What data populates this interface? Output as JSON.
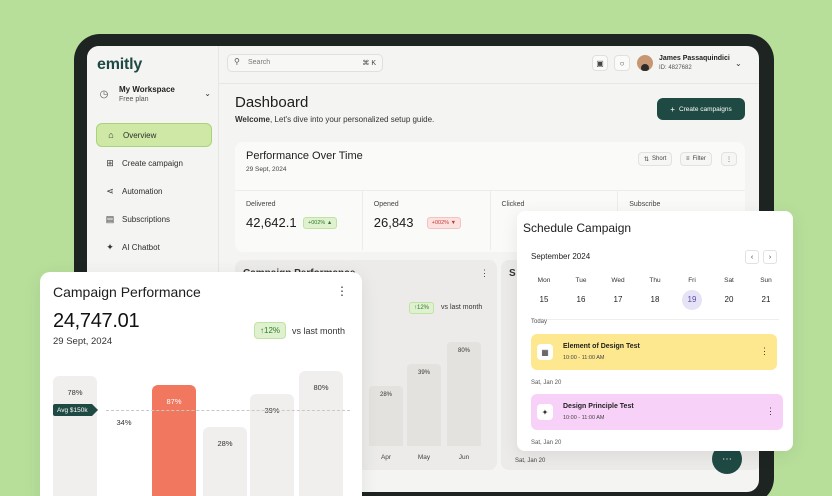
{
  "brand": {
    "logo": "emitly"
  },
  "workspace": {
    "name": "My Workspace",
    "plan": "Free plan"
  },
  "nav": [
    {
      "label": "Overview",
      "icon": "home-icon",
      "active": true
    },
    {
      "label": "Create campaign",
      "icon": "plus-square-icon"
    },
    {
      "label": "Automation",
      "icon": "share-nodes-icon"
    },
    {
      "label": "Subscriptions",
      "icon": "ticket-icon"
    },
    {
      "label": "AI Chatbot",
      "icon": "sparkle-icon"
    }
  ],
  "search": {
    "placeholder": "Search",
    "shortcut": "⌘  K"
  },
  "user": {
    "name": "James Passaquindici",
    "id": "ID: 4827682"
  },
  "dashboard": {
    "title": "Dashboard",
    "welcome_bold": "Welcome",
    "welcome_rest": ", Let's dive into your personalized setup guide.",
    "create_button": "Create campaigns"
  },
  "performance": {
    "title": "Performance Over Time",
    "date": "29 Sept, 2024",
    "short_label": "Short",
    "filter_label": "Filter",
    "metrics": [
      {
        "label": "Delivered",
        "value": "42,642.1",
        "change": "+002%",
        "trend": "up"
      },
      {
        "label": "Opened",
        "value": "26,843",
        "change": "+002%",
        "trend": "down"
      },
      {
        "label": "Clicked",
        "value": "",
        "change": "",
        "trend": ""
      },
      {
        "label": "Subscribe",
        "value": "",
        "change": "",
        "trend": ""
      }
    ]
  },
  "campaign_back": {
    "title": "Campaign Performance",
    "change": "↑12%",
    "vs": "vs last month",
    "bars": [
      {
        "label": "",
        "value": "28%",
        "month": "Apr"
      },
      {
        "label": "",
        "value": "39%",
        "month": "May"
      },
      {
        "label": "",
        "value": "80%",
        "month": "Jun"
      }
    ]
  },
  "schedule_back": {
    "title": "S",
    "date": "Sat, Jan 20"
  },
  "campaign_card": {
    "title": "Campaign Performance",
    "value": "24,747.01",
    "date": "29 Sept, 2024",
    "change": "↑12%",
    "vs": "vs last month",
    "avg_label": "Avg $150k",
    "bars": [
      {
        "value": "78%",
        "highlight": false
      },
      {
        "value": "34%",
        "highlight": false
      },
      {
        "value": "87%",
        "highlight": true
      },
      {
        "value": "28%",
        "highlight": false
      },
      {
        "value": "39%",
        "highlight": false
      },
      {
        "value": "80%",
        "highlight": false
      }
    ]
  },
  "schedule": {
    "title": "Schedule Campaign",
    "month": "September 2024",
    "days": [
      {
        "name": "Mon",
        "date": "15"
      },
      {
        "name": "Tue",
        "date": "16"
      },
      {
        "name": "Wed",
        "date": "17"
      },
      {
        "name": "Thu",
        "date": "18"
      },
      {
        "name": "Fri",
        "date": "19",
        "selected": true
      },
      {
        "name": "Sat",
        "date": "20"
      },
      {
        "name": "Sun",
        "date": "21"
      }
    ],
    "today_label": "Today",
    "events": [
      {
        "title": "Element of Design Test",
        "time": "10:00 - 11:00 AM",
        "color": "#fde88f",
        "group": "Today"
      },
      {
        "title": "Design Principle Test",
        "time": "10:00 - 11:00 AM",
        "color": "#f8d1f8",
        "group": "Sat, Jan 20"
      }
    ],
    "group2_label": "Sat, Jan 20",
    "group3_label": "Sat, Jan 20"
  },
  "colors": {
    "brand": "#1f4a44",
    "accent_green": "#cfe8a5",
    "highlight_bar": "#f1775f",
    "background": "#b7df9a"
  }
}
